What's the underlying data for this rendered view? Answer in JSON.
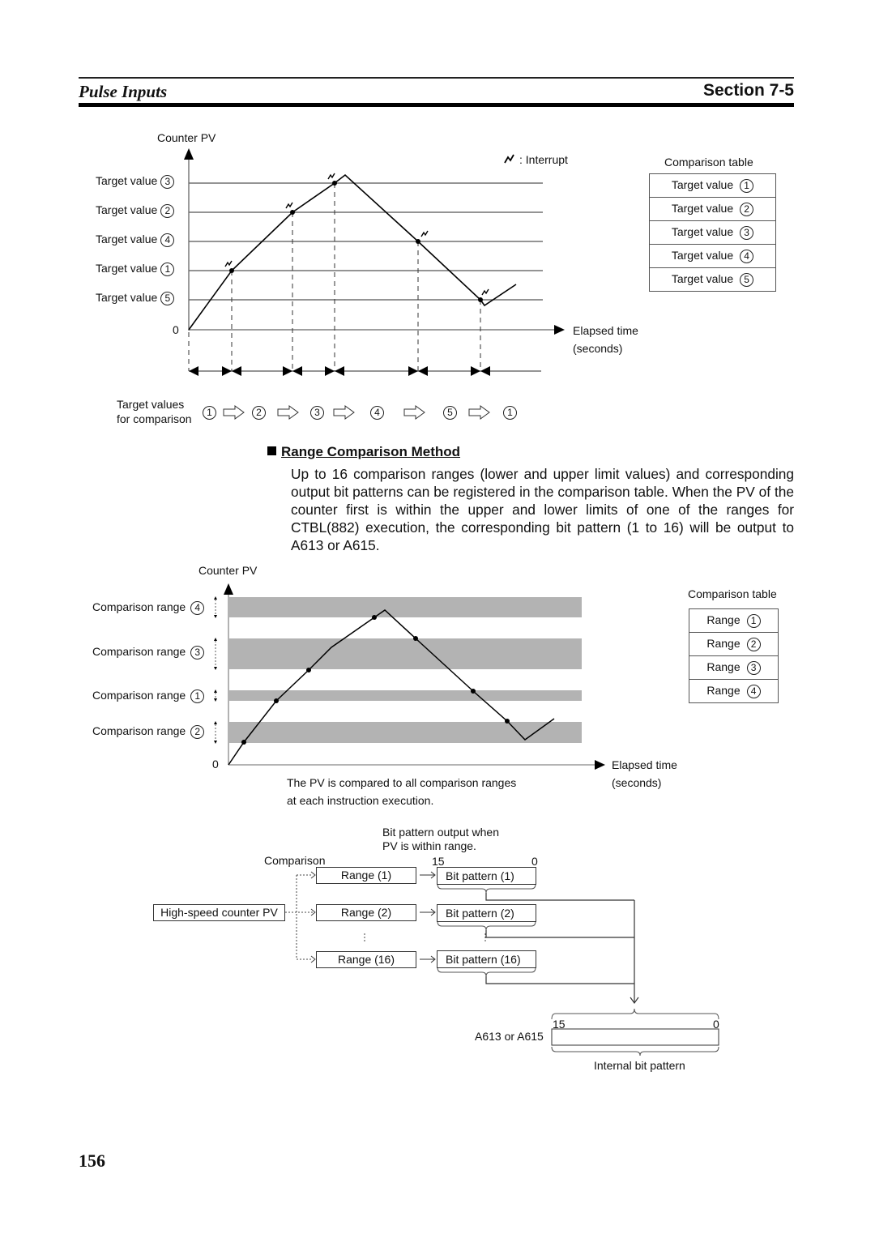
{
  "header": {
    "title": "Pulse Inputs",
    "section": "Section 7-5"
  },
  "page_number": "156",
  "figure1": {
    "y_axis_label": "Counter PV",
    "zero_label": "0",
    "x_axis_label_line1": "Elapsed time",
    "x_axis_label_line2": "(seconds)",
    "legend": {
      "icon": "interrupt-icon",
      "label": ": Interrupt"
    },
    "target_value_prefix": "Target value",
    "y_labels": [
      {
        "text": "Target value",
        "num": "3"
      },
      {
        "text": "Target value",
        "num": "2"
      },
      {
        "text": "Target value",
        "num": "4"
      },
      {
        "text": "Target value",
        "num": "1"
      },
      {
        "text": "Target value",
        "num": "5"
      }
    ],
    "comparison_table": {
      "title": "Comparison table",
      "rows": [
        {
          "text": "Target value",
          "num": "1"
        },
        {
          "text": "Target value",
          "num": "2"
        },
        {
          "text": "Target value",
          "num": "3"
        },
        {
          "text": "Target value",
          "num": "4"
        },
        {
          "text": "Target value",
          "num": "5"
        }
      ]
    },
    "sequence_label_line1": "Target values",
    "sequence_label_line2": "for comparison",
    "sequence": [
      "1",
      "2",
      "3",
      "4",
      "5",
      "1"
    ]
  },
  "section": {
    "heading": "Range Comparison Method",
    "paragraph": "Up to 16 comparison ranges (lower and upper limit values) and corresponding output bit patterns can be registered in the comparison table. When the PV of the counter first is within the upper and lower limits of one of the ranges for CTBL(882) execution, the corresponding bit pattern (1 to 16) will be output to A613 or A615."
  },
  "figure2": {
    "y_axis_label": "Counter PV",
    "zero_label": "0",
    "x_axis_label_line1": "Elapsed time",
    "x_axis_label_line2": "(seconds)",
    "range_labels": [
      {
        "text": "Comparison range",
        "num": "4"
      },
      {
        "text": "Comparison range",
        "num": "3"
      },
      {
        "text": "Comparison range",
        "num": "1"
      },
      {
        "text": "Comparison range",
        "num": "2"
      }
    ],
    "caption_line1": "The PV is compared to all comparison ranges",
    "caption_line2": "at each instruction execution.",
    "comparison_table": {
      "title": "Comparison table",
      "rows": [
        {
          "text": "Range",
          "num": "1"
        },
        {
          "text": "Range",
          "num": "2"
        },
        {
          "text": "Range",
          "num": "3"
        },
        {
          "text": "Range",
          "num": "4"
        }
      ]
    },
    "band_color": "#b3b3b3"
  },
  "figure3": {
    "bit_output_note_line1": "Bit pattern output when",
    "bit_output_note_line2": "PV is within range.",
    "comparison_label": "Comparison",
    "bit15": "15",
    "bit0": "0",
    "source": "High-speed counter PV",
    "ranges": [
      "Range (1)",
      "Range (2)",
      "Range (16)"
    ],
    "patterns": [
      "Bit pattern (1)",
      "Bit pattern (2)",
      "Bit pattern (16)"
    ],
    "dest_label": "A613 or A615",
    "dest_bit15": "15",
    "dest_bit0": "0",
    "dest_caption": "Internal bit pattern"
  }
}
